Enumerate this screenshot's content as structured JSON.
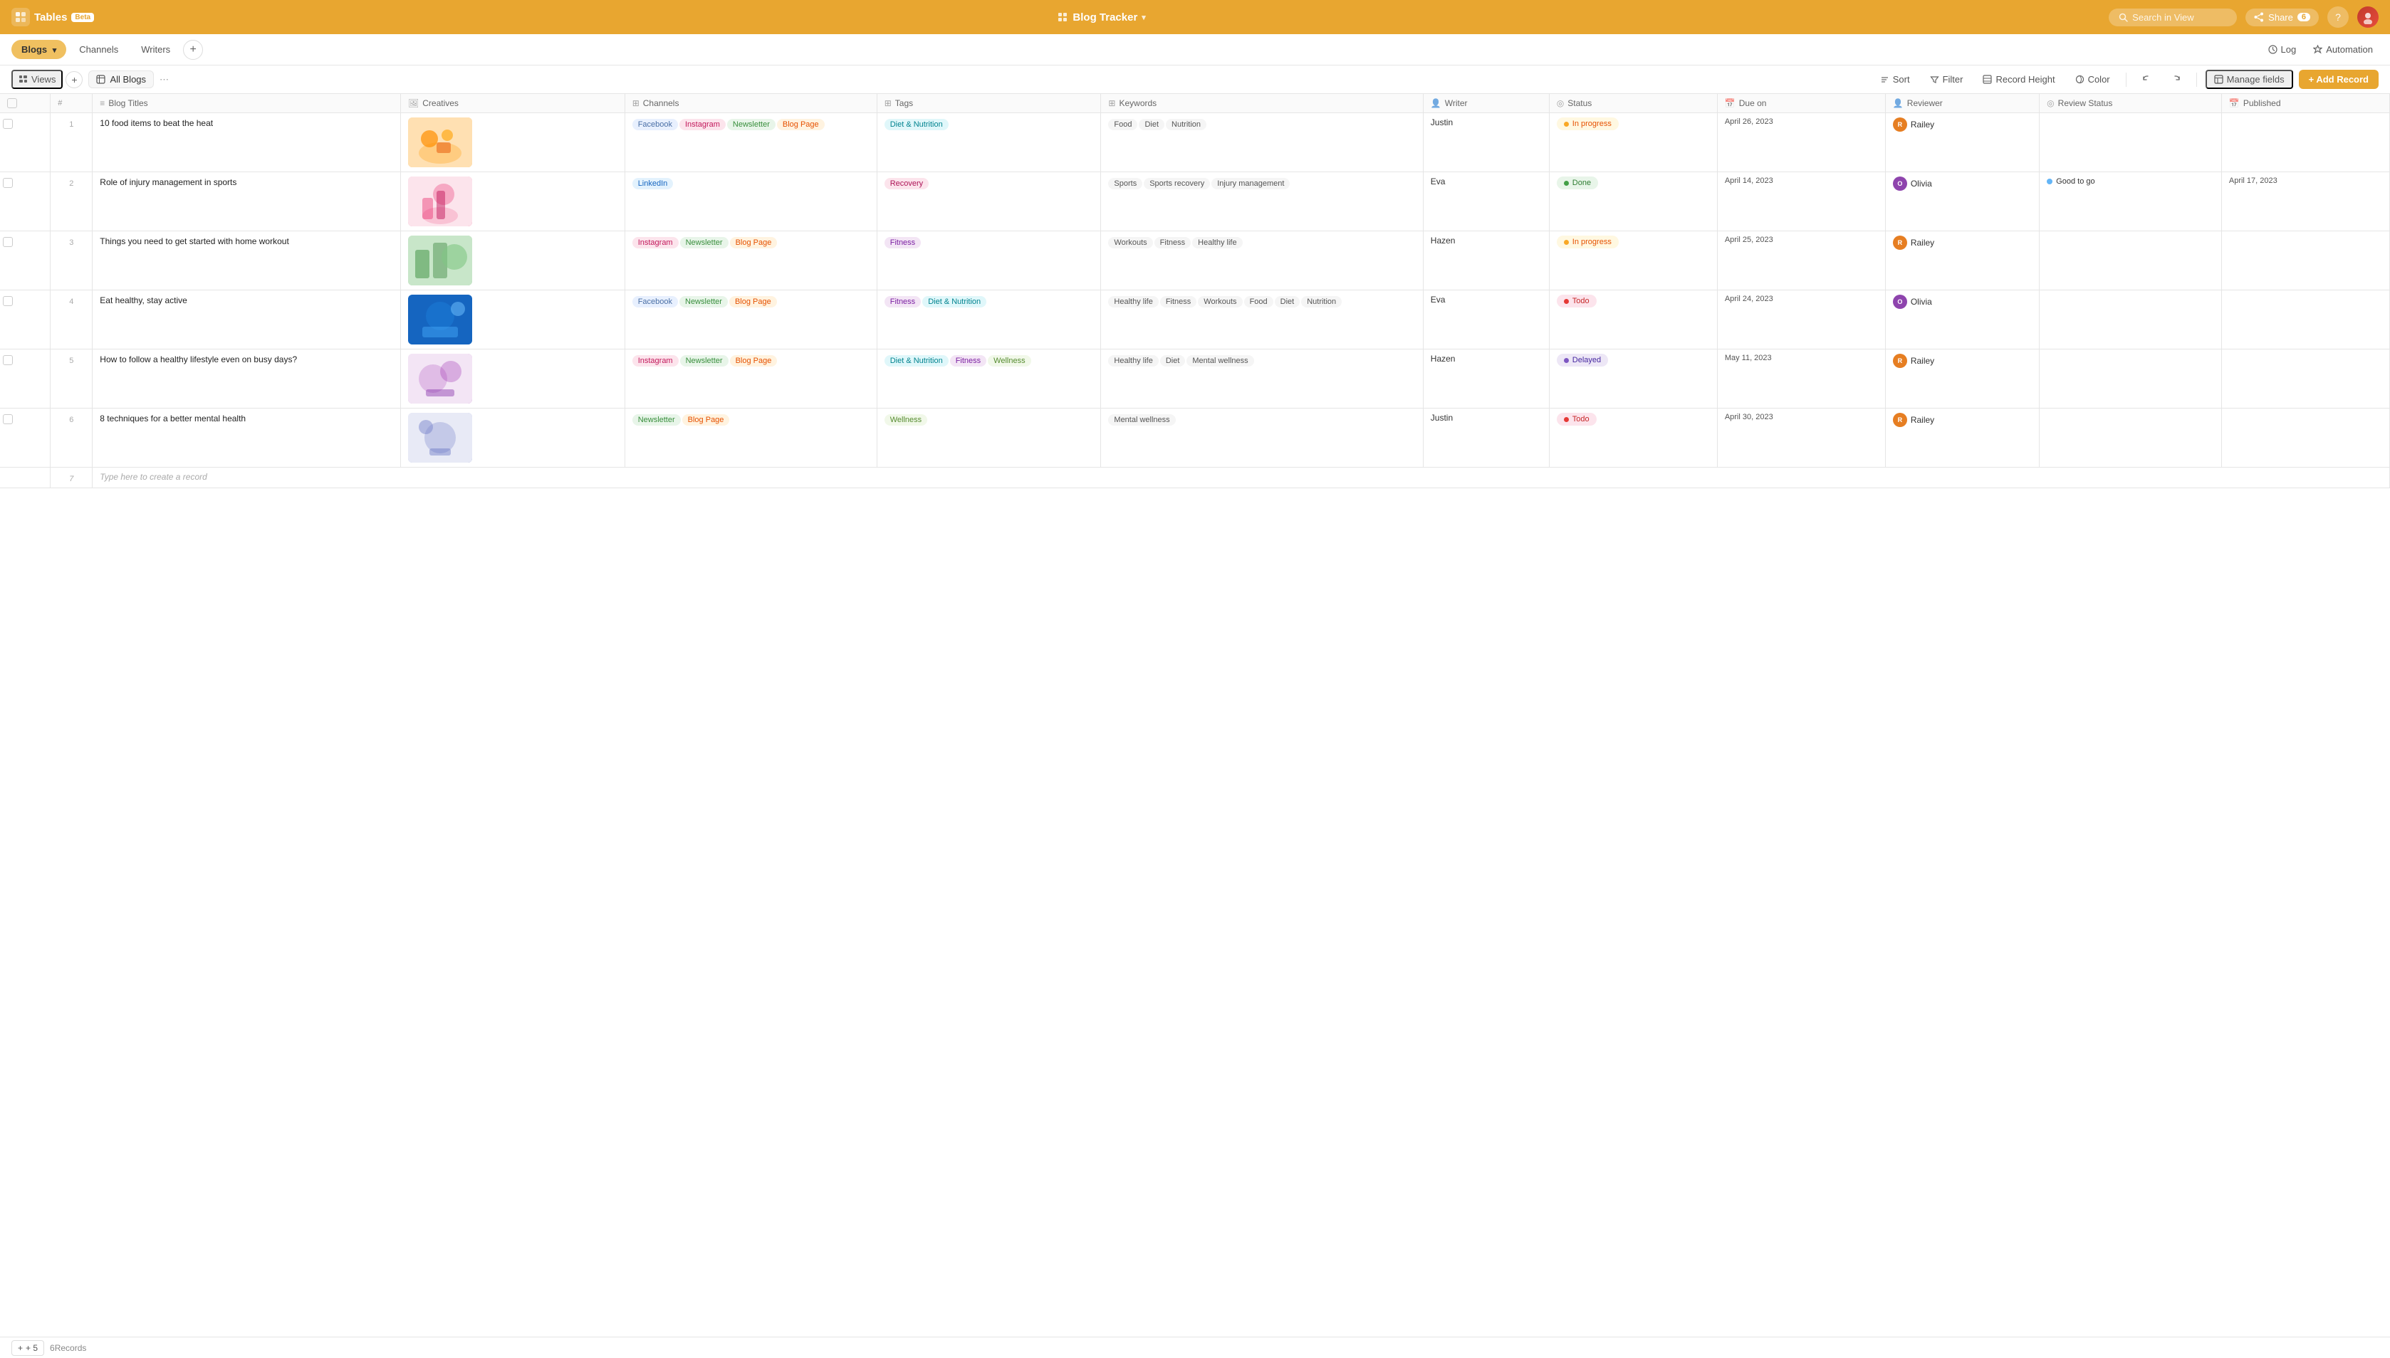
{
  "app": {
    "logo": "🔷",
    "name": "Tables",
    "beta": "Beta",
    "title": "Blog Tracker",
    "title_chevron": "▾"
  },
  "nav": {
    "search_placeholder": "Search in View",
    "share_label": "Share",
    "share_count": "6",
    "help_icon": "?",
    "log_label": "Log",
    "automation_label": "Automation"
  },
  "tabs": [
    {
      "id": "blogs",
      "label": "Blogs",
      "active": true
    },
    {
      "id": "channels",
      "label": "Channels",
      "active": false
    },
    {
      "id": "writers",
      "label": "Writers",
      "active": false
    }
  ],
  "toolbar": {
    "views_label": "Views",
    "current_view": "All Blogs",
    "sort_label": "Sort",
    "filter_label": "Filter",
    "record_height_label": "Record Height",
    "color_label": "Color",
    "manage_fields_label": "Manage fields",
    "add_record_label": "+ Add Record",
    "undo_icon": "↩",
    "redo_icon": "↪"
  },
  "columns": [
    {
      "id": "check",
      "label": "",
      "icon": ""
    },
    {
      "id": "num",
      "label": "#",
      "icon": ""
    },
    {
      "id": "title",
      "label": "Blog Titles",
      "icon": "≡"
    },
    {
      "id": "creatives",
      "label": "Creatives",
      "icon": "🖼"
    },
    {
      "id": "channels",
      "label": "Channels",
      "icon": "⊞"
    },
    {
      "id": "tags",
      "label": "Tags",
      "icon": "⊞"
    },
    {
      "id": "keywords",
      "label": "Keywords",
      "icon": "⊞"
    },
    {
      "id": "writer",
      "label": "Writer",
      "icon": "👤"
    },
    {
      "id": "status",
      "label": "Status",
      "icon": "◎"
    },
    {
      "id": "dueon",
      "label": "Due on",
      "icon": "📅"
    },
    {
      "id": "reviewer",
      "label": "Reviewer",
      "icon": "👤"
    },
    {
      "id": "reviewstatus",
      "label": "Review Status",
      "icon": "◎"
    },
    {
      "id": "published",
      "label": "Published",
      "icon": "📅"
    }
  ],
  "rows": [
    {
      "num": "1",
      "title": "10 food items to beat the heat",
      "illus_class": "illus-1",
      "channels": [
        "Facebook",
        "Instagram",
        "Newsletter",
        "Blog Page"
      ],
      "channels_classes": [
        "facebook",
        "instagram",
        "newsletter",
        "blogpage"
      ],
      "tags": [
        "Diet & Nutrition"
      ],
      "tags_classes": [
        "diet"
      ],
      "keywords": [
        "Food",
        "Diet",
        "Nutrition"
      ],
      "keywords_classes": [
        "keyword",
        "keyword",
        "keyword"
      ],
      "writer": "Justin",
      "status": "In progress",
      "status_class": "status-inprogress",
      "dot_class": "dot-inprogress",
      "due_on": "April 26, 2023",
      "reviewer": "Railey",
      "reviewer_color": "#e67e22",
      "review_status": "",
      "published": ""
    },
    {
      "num": "2",
      "title": "Role of injury management in sports",
      "illus_class": "illus-2",
      "channels": [
        "LinkedIn"
      ],
      "channels_classes": [
        "linkedin"
      ],
      "tags": [
        "Recovery"
      ],
      "tags_classes": [
        "recovery"
      ],
      "keywords": [
        "Sports",
        "Sports recovery",
        "Injury management"
      ],
      "keywords_classes": [
        "keyword",
        "keyword",
        "keyword"
      ],
      "writer": "Eva",
      "status": "Done",
      "status_class": "status-done",
      "dot_class": "dot-done",
      "due_on": "April 14, 2023",
      "reviewer": "Olivia",
      "reviewer_color": "#8e44ad",
      "review_status": "Good to go",
      "review_status_color": "#64b5f6",
      "published": "April 17, 2023"
    },
    {
      "num": "3",
      "title": "Things you need to get started with home workout",
      "illus_class": "illus-3",
      "channels": [
        "Instagram",
        "Newsletter",
        "Blog Page"
      ],
      "channels_classes": [
        "instagram",
        "newsletter",
        "blogpage"
      ],
      "tags": [
        "Fitness"
      ],
      "tags_classes": [
        "fitness"
      ],
      "keywords": [
        "Workouts",
        "Fitness",
        "Healthy life"
      ],
      "keywords_classes": [
        "keyword",
        "keyword",
        "keyword"
      ],
      "writer": "Hazen",
      "status": "In progress",
      "status_class": "status-inprogress",
      "dot_class": "dot-inprogress",
      "due_on": "April 25, 2023",
      "reviewer": "Railey",
      "reviewer_color": "#e67e22",
      "review_status": "",
      "published": ""
    },
    {
      "num": "4",
      "title": "Eat healthy, stay active",
      "illus_class": "illus-4",
      "channels": [
        "Facebook",
        "Newsletter",
        "Blog Page"
      ],
      "channels_classes": [
        "facebook",
        "newsletter",
        "blogpage"
      ],
      "tags": [
        "Fitness",
        "Diet & Nutrition"
      ],
      "tags_classes": [
        "fitness",
        "diet"
      ],
      "keywords": [
        "Healthy life",
        "Fitness",
        "Workouts",
        "Food",
        "Diet",
        "Nutrition"
      ],
      "keywords_classes": [
        "keyword",
        "keyword",
        "keyword",
        "keyword",
        "keyword",
        "keyword"
      ],
      "writer": "Eva",
      "status": "Todo",
      "status_class": "status-todo",
      "dot_class": "dot-todo",
      "due_on": "April 24, 2023",
      "reviewer": "Olivia",
      "reviewer_color": "#8e44ad",
      "review_status": "",
      "published": ""
    },
    {
      "num": "5",
      "title": "How to follow a healthy lifestyle even on busy days?",
      "illus_class": "illus-5",
      "channels": [
        "Instagram",
        "Newsletter",
        "Blog Page"
      ],
      "channels_classes": [
        "instagram",
        "newsletter",
        "blogpage"
      ],
      "tags": [
        "Diet & Nutrition",
        "Fitness",
        "Wellness"
      ],
      "tags_classes": [
        "diet",
        "fitness",
        "wellness"
      ],
      "keywords": [
        "Healthy life",
        "Diet",
        "Mental wellness"
      ],
      "keywords_classes": [
        "keyword",
        "keyword",
        "keyword"
      ],
      "writer": "Hazen",
      "status": "Delayed",
      "status_class": "status-delayed",
      "dot_class": "dot-delayed",
      "due_on": "May 11, 2023",
      "reviewer": "Railey",
      "reviewer_color": "#e67e22",
      "review_status": "",
      "published": ""
    },
    {
      "num": "6",
      "title": "8 techniques for a better mental health",
      "illus_class": "illus-6",
      "channels": [
        "Newsletter",
        "Blog Page"
      ],
      "channels_classes": [
        "newsletter",
        "blogpage"
      ],
      "tags": [
        "Wellness"
      ],
      "tags_classes": [
        "wellness"
      ],
      "keywords": [
        "Mental wellness"
      ],
      "keywords_classes": [
        "keyword"
      ],
      "writer": "Justin",
      "status": "Todo",
      "status_class": "status-todo",
      "dot_class": "dot-todo",
      "due_on": "April 30, 2023",
      "reviewer": "Railey",
      "reviewer_color": "#e67e22",
      "review_status": "",
      "published": ""
    }
  ],
  "create_row_placeholder": "Type here to create a record",
  "footer": {
    "add_label": "+ 5",
    "records_count": "6Records"
  }
}
